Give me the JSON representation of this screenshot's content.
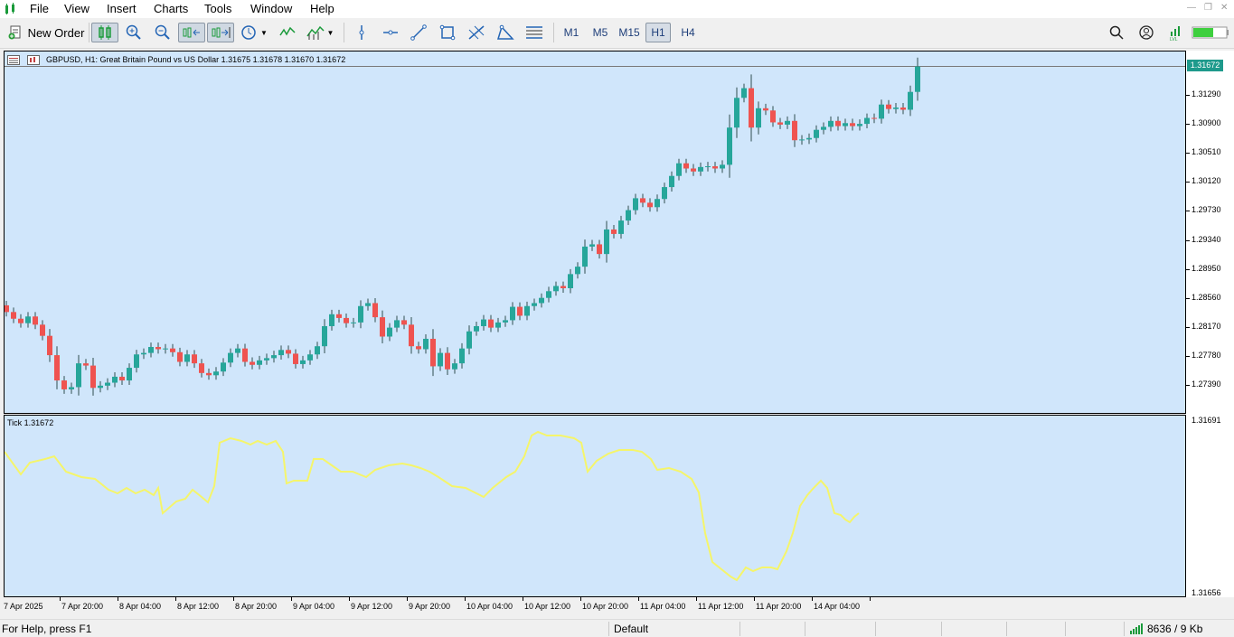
{
  "menu": {
    "items": [
      "File",
      "View",
      "Insert",
      "Charts",
      "Tools",
      "Window",
      "Help"
    ]
  },
  "toolbar": {
    "new_order_label": "New Order",
    "timeframes": [
      "M1",
      "M5",
      "M15",
      "H1",
      "H4"
    ],
    "active_timeframe": "H1"
  },
  "chart": {
    "title": "GBPUSD, H1:  Great Britain Pound vs US Dollar  1.31675 1.31678 1.31670 1.31672",
    "current_price_label": "1.31672",
    "price_scale": [
      "1.31290",
      "1.30900",
      "1.30510",
      "1.30120",
      "1.29730",
      "1.29340",
      "1.28950",
      "1.28560",
      "1.28170",
      "1.27780",
      "1.27390"
    ],
    "time_scale": [
      "7 Apr 2025",
      "7 Apr 20:00",
      "8 Apr 04:00",
      "8 Apr 12:00",
      "8 Apr 20:00",
      "9 Apr 04:00",
      "9 Apr 12:00",
      "9 Apr 20:00",
      "10 Apr 04:00",
      "10 Apr 12:00",
      "10 Apr 20:00",
      "11 Apr 04:00",
      "11 Apr 12:00",
      "11 Apr 20:00",
      "14 Apr 04:00"
    ],
    "bull_color": "#26a69a",
    "bear_color": "#ef5350",
    "background_color": "#d0e6fb"
  },
  "indicator": {
    "label": "Tick 1.31672",
    "scale_top": "1.31691",
    "scale_bottom": "1.31656",
    "line_color": "#f5f56a"
  },
  "statusbar": {
    "help": "For Help, press F1",
    "profile": "Default",
    "traffic": "8636 / 9 Kb"
  },
  "chart_data": {
    "type": "candlestick",
    "title": "GBPUSD, H1:  Great Britain Pound vs US Dollar  1.31675 1.31678 1.31670 1.31672",
    "close": [
      1.2837,
      1.2828,
      1.2822,
      1.2831,
      1.282,
      1.2805,
      1.2779,
      1.2745,
      1.2733,
      1.2736,
      1.2768,
      1.2765,
      1.2735,
      1.2738,
      1.2742,
      1.275,
      1.2745,
      1.2762,
      1.278,
      1.2782,
      1.279,
      1.2787,
      1.2788,
      1.2783,
      1.277,
      1.278,
      1.2768,
      1.2755,
      1.2752,
      1.2757,
      1.2769,
      1.2782,
      1.2788,
      1.277,
      1.2766,
      1.2772,
      1.2775,
      1.2779,
      1.2786,
      1.2781,
      1.2767,
      1.2772,
      1.278,
      1.2791,
      1.2818,
      1.2834,
      1.2829,
      1.2822,
      1.2823,
      1.2845,
      1.2849,
      1.283,
      1.2804,
      1.2816,
      1.2826,
      1.282,
      1.2791,
      1.2787,
      1.2801,
      1.2764,
      1.2782,
      1.276,
      1.2768,
      1.2788,
      1.2811,
      1.2818,
      1.2827,
      1.2816,
      1.2823,
      1.2826,
      1.2844,
      1.2832,
      1.2845,
      1.2849,
      1.2856,
      1.2865,
      1.2872,
      1.2869,
      1.2888,
      1.2898,
      1.2925,
      1.2928,
      1.2915,
      1.2948,
      1.2942,
      1.296,
      1.2974,
      1.299,
      1.2984,
      1.2978,
      1.2989,
      1.3005,
      1.302,
      1.3037,
      1.303,
      1.3026,
      1.3032,
      1.3033,
      1.303,
      1.3035,
      1.3085,
      1.3125,
      1.3138,
      1.3085,
      1.3111,
      1.3108,
      1.3092,
      1.3089,
      1.3094,
      1.3068,
      1.3069,
      1.3071,
      1.3082,
      1.3086,
      1.3094,
      1.3087,
      1.3091,
      1.3087,
      1.309,
      1.3098,
      1.3097,
      1.3116,
      1.311,
      1.3112,
      1.3109,
      1.3133,
      1.31672
    ]
  }
}
